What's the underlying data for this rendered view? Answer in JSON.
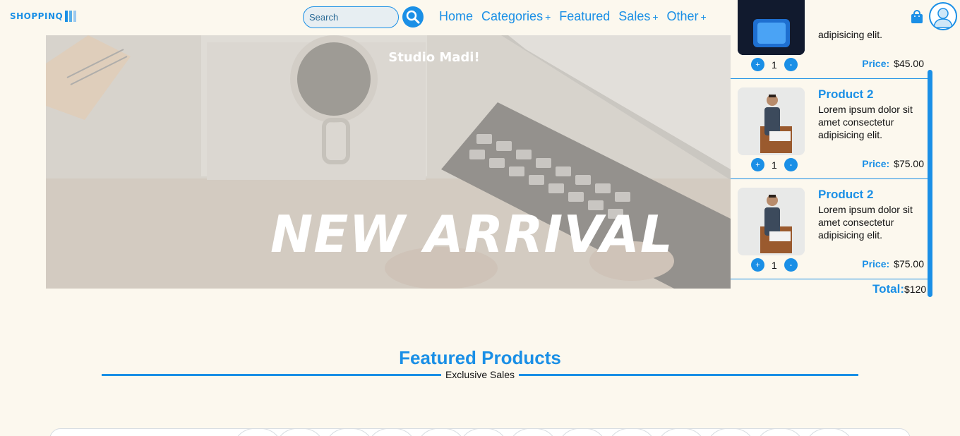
{
  "header": {
    "logo_text": "SHOPPINQ",
    "search": {
      "placeholder": "Search"
    },
    "nav": [
      {
        "label": "Home",
        "has_submenu": false
      },
      {
        "label": "Categories",
        "has_submenu": true
      },
      {
        "label": "Featured",
        "has_submenu": false
      },
      {
        "label": "Sales",
        "has_submenu": true
      },
      {
        "label": "Other",
        "has_submenu": true
      }
    ],
    "submenu_marker": "+"
  },
  "hero": {
    "small_title": "Studio Madi!",
    "big_title": "NEW ARRIVAL"
  },
  "cart": {
    "items": [
      {
        "name": "",
        "desc": "adipisicing elit.",
        "qty": "1",
        "price_label": "Price:",
        "price": "$45.00"
      },
      {
        "name": "Product 2",
        "desc": "Lorem ipsum dolor sit amet consectetur adipisicing elit.",
        "qty": "1",
        "price_label": "Price:",
        "price": "$75.00"
      },
      {
        "name": "Product 2",
        "desc": "Lorem ipsum dolor sit amet consectetur adipisicing elit.",
        "qty": "1",
        "price_label": "Price:",
        "price": "$75.00"
      }
    ],
    "plus": "+",
    "minus": "-",
    "total_label": "Total:",
    "total_value": "$120"
  },
  "featured": {
    "title": "Featured Products",
    "subtitle": "Exclusive Sales"
  },
  "colors": {
    "accent": "#1a8fe6",
    "background": "#fcf8ee"
  }
}
